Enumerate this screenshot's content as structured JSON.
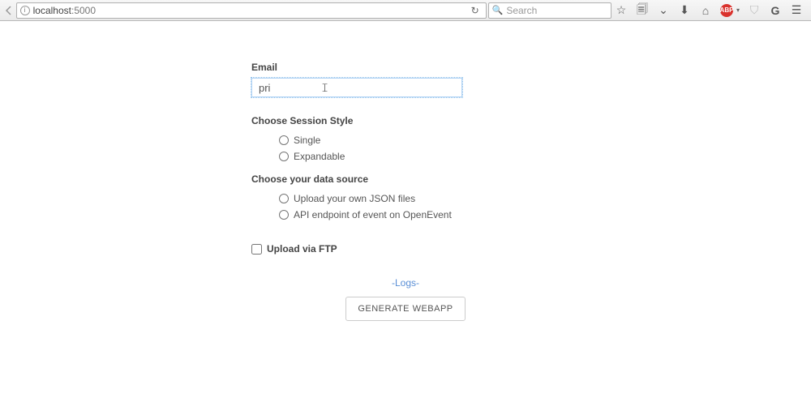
{
  "browser": {
    "url_host": "localhost",
    "url_port": ":5000",
    "search_placeholder": "Search"
  },
  "form": {
    "email_label": "Email",
    "email_value": "pri",
    "session_style": {
      "title": "Choose Session Style",
      "options": [
        "Single",
        "Expandable"
      ]
    },
    "data_source": {
      "title": "Choose your data source",
      "options": [
        "Upload your own JSON files",
        "API endpoint of event on OpenEvent"
      ]
    },
    "ftp_label": "Upload via FTP",
    "logs_label": "-Logs-",
    "generate_label": "GENERATE WEBAPP"
  }
}
